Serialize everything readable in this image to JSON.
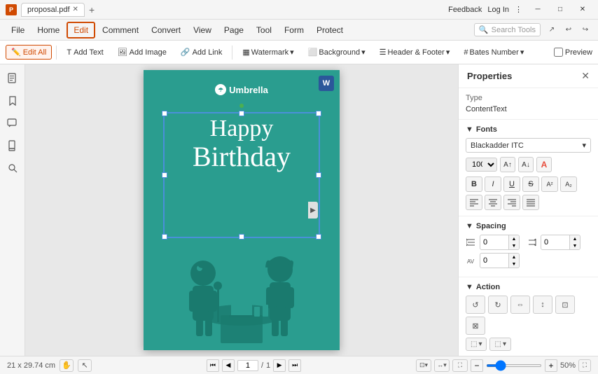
{
  "titlebar": {
    "tab_name": "proposal.pdf",
    "feedback_label": "Feedback",
    "login_label": "Log In"
  },
  "menubar": {
    "items": [
      {
        "label": "File",
        "active": false
      },
      {
        "label": "Home",
        "active": false
      },
      {
        "label": "Edit",
        "active": true
      },
      {
        "label": "Comment",
        "active": false
      },
      {
        "label": "Convert",
        "active": false
      },
      {
        "label": "View",
        "active": false
      },
      {
        "label": "Page",
        "active": false
      },
      {
        "label": "Tool",
        "active": false
      },
      {
        "label": "Form",
        "active": false
      },
      {
        "label": "Protect",
        "active": false
      }
    ],
    "search_placeholder": "Search Tools"
  },
  "toolbar": {
    "edit_all_label": "Edit All",
    "add_text_label": "Add Text",
    "add_image_label": "Add Image",
    "add_link_label": "Add Link",
    "watermark_label": "Watermark",
    "background_label": "Background",
    "header_footer_label": "Header & Footer",
    "bates_number_label": "Bates Number",
    "preview_label": "Preview"
  },
  "left_sidebar": {
    "icons": [
      "pages",
      "bookmarks",
      "comments",
      "attachments",
      "search"
    ]
  },
  "properties_panel": {
    "title": "Properties",
    "type_label": "Type",
    "type_value": "ContentText",
    "fonts_section": "Fonts",
    "font_name": "Blackadder ITC",
    "font_size": "100",
    "font_color_icon": "A",
    "styles": [
      "B",
      "I",
      "U",
      "S",
      "A²",
      "A₂"
    ],
    "alignments": [
      "align-left",
      "align-center",
      "align-right",
      "align-justify"
    ],
    "spacing_section": "Spacing",
    "line_spacing_value": "0",
    "para_spacing_value": "0",
    "char_spacing_value": "0",
    "action_section": "Action"
  },
  "canvas": {
    "umbrella_text": "Umbrella",
    "happy_text": "Happy",
    "birthday_text": "Birthday",
    "word_icon": "W"
  },
  "statusbar": {
    "dimensions": "21 x 29.74 cm",
    "page_display": "1/1",
    "zoom_level": "50%"
  }
}
